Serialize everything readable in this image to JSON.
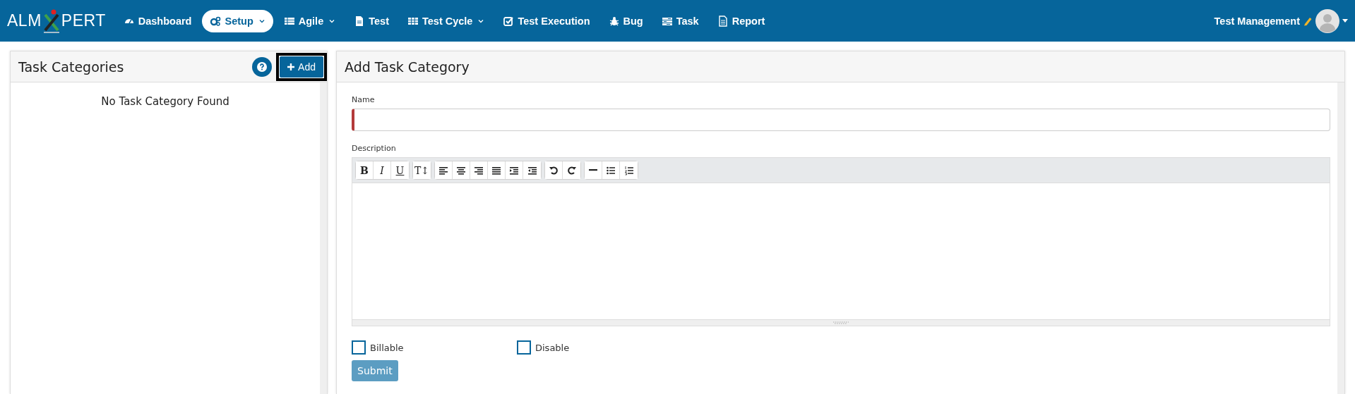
{
  "brand": {
    "left": "ALM",
    "right": "PERT"
  },
  "nav": [
    {
      "label": "Dashboard",
      "selected": false,
      "dropdown": false
    },
    {
      "label": "Setup",
      "selected": true,
      "dropdown": true
    },
    {
      "label": "Agile",
      "selected": false,
      "dropdown": true
    },
    {
      "label": "Test",
      "selected": false,
      "dropdown": false
    },
    {
      "label": "Test Cycle",
      "selected": false,
      "dropdown": true
    },
    {
      "label": "Test Execution",
      "selected": false,
      "dropdown": false
    },
    {
      "label": "Bug",
      "selected": false,
      "dropdown": false
    },
    {
      "label": "Task",
      "selected": false,
      "dropdown": false
    },
    {
      "label": "Report",
      "selected": false,
      "dropdown": false
    }
  ],
  "user": {
    "project": "Test Management"
  },
  "list_panel": {
    "title": "Task Categories",
    "add_button": "Add",
    "empty_message": "No Task Category Found"
  },
  "form_panel": {
    "title": "Add Task Category",
    "name_field": {
      "label": "Name",
      "required": true
    },
    "description": {
      "label": "Description",
      "toolbar_text": [
        "B",
        "I",
        "U",
        "T↕"
      ]
    },
    "checkboxes": [
      {
        "label": "Billable",
        "checked": false
      },
      {
        "label": "Disable",
        "checked": false
      }
    ],
    "submit": {
      "label": "Submit",
      "disabled": true
    }
  }
}
